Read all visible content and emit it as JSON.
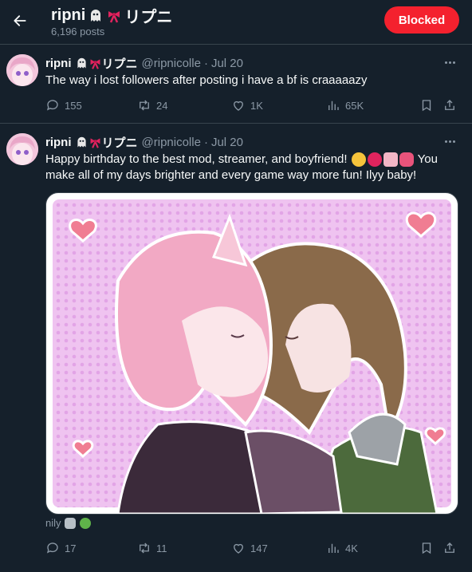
{
  "header": {
    "profile_name": "ripni",
    "profile_suffix": "リプニ",
    "post_count": "6,196 posts",
    "blocked_label": "Blocked"
  },
  "tweets": [
    {
      "name": "ripni",
      "name_suffix": "リプニ",
      "handle": "@ripnicolle",
      "dot": "·",
      "date": "Jul 20",
      "text": "The way i lost followers after posting i have a bf is craaaaazy",
      "replies": "155",
      "reposts": "24",
      "likes": "1K",
      "views": "65K"
    },
    {
      "name": "ripni",
      "name_suffix": "リプニ",
      "handle": "@ripnicolle",
      "dot": "·",
      "date": "Jul 20",
      "text_part1": "Happy birthday to the best mod, streamer, and boyfriend!",
      "text_part2": "You make all of my days brighter and every game way more fun! Ilyy baby!",
      "caption": "nily",
      "replies": "17",
      "reposts": "11",
      "likes": "147",
      "views": "4K"
    }
  ],
  "icons": {
    "back": "arrow-left-icon",
    "more": "more-horizontal-icon",
    "reply": "reply-icon",
    "repost": "repost-icon",
    "like": "heart-icon",
    "views": "views-icon",
    "bookmark": "bookmark-icon",
    "share": "share-icon"
  },
  "colors": {
    "background": "#15202b",
    "blocked": "#f4212e",
    "muted": "#8b98a5",
    "divider": "#38444d"
  }
}
